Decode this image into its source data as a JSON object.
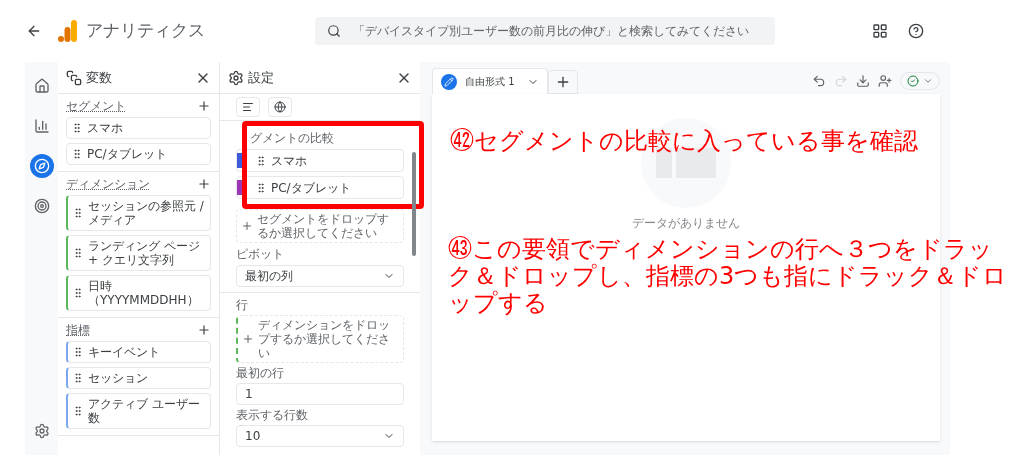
{
  "app": {
    "title": "アナリティクス",
    "search_placeholder": "「デバイスタイプ別ユーザー数の前月比の伸び」と検索してみてください"
  },
  "rail": [
    {
      "selected": false
    },
    {
      "selected": false
    },
    {
      "selected": true
    },
    {
      "selected": false
    }
  ],
  "variables": {
    "title": "変数",
    "sections": [
      {
        "label": "セグメント",
        "kind": "segment",
        "items": [
          "スマホ",
          "PC/タブレット"
        ]
      },
      {
        "label": "ディメンション",
        "kind": "dimension",
        "items": [
          "セッションの参照元 / メディア",
          "ランディング ページ + クエリ文字列",
          "日時（YYYYMMDDHH）"
        ]
      },
      {
        "label": "指標",
        "kind": "metric",
        "items": [
          "キーイベント",
          "セッション",
          "アクティブ ユーザー数"
        ]
      }
    ]
  },
  "settings": {
    "title": "設定",
    "segment_compare": {
      "label": "グメントの比較",
      "items": [
        {
          "name": "スマホ",
          "color": "#3b5bdb"
        },
        {
          "name": "PC/タブレット",
          "color": "#9c36b5"
        }
      ],
      "drop_hint": "セグメントをドロップするか選択してください"
    },
    "pivot": {
      "label": "ピボット",
      "value": "最初の列"
    },
    "rows": {
      "label": "行",
      "drop_hint": "ディメンションをドロップするか選択してください"
    },
    "first_row": {
      "label": "最初の行",
      "value": "1"
    },
    "rows_shown": {
      "label": "表示する行数",
      "value": "10"
    }
  },
  "tabs": [
    {
      "label": "自由形式 1",
      "selected": true
    }
  ],
  "canvas": {
    "no_data": "データがありません"
  },
  "annotations": [
    "㊷セグメントの比較に入っている事を確認",
    "㊸この要領でディメンションの行へ３つをドラック＆ドロップし、指標の3つも指にドラック＆ドロップする"
  ]
}
